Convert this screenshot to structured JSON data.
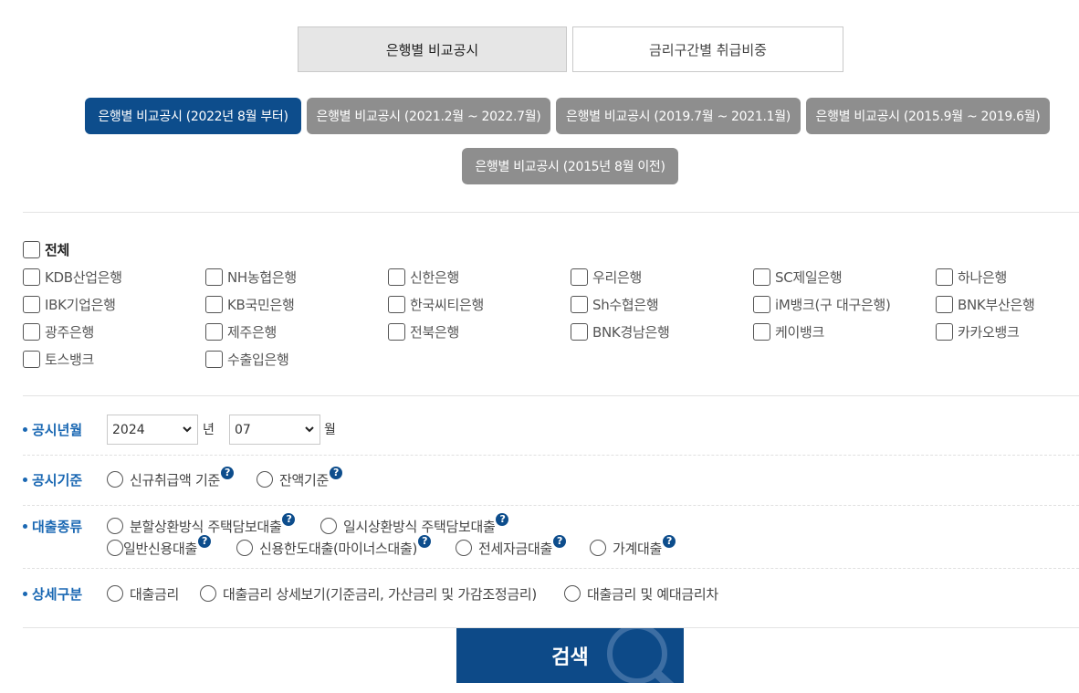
{
  "top_tabs": [
    {
      "label": "은행별 비교공시",
      "active": true
    },
    {
      "label": "금리구간별 취급비중",
      "active": false
    }
  ],
  "period_tabs": [
    {
      "label": "은행별 비교공시 (2022년 8월 부터)",
      "active": true
    },
    {
      "label": "은행별 비교공시 (2021.2월 ~ 2022.7월)",
      "active": false
    },
    {
      "label": "은행별 비교공시 (2019.7월 ~ 2021.1월)",
      "active": false
    },
    {
      "label": "은행별 비교공시 (2015.9월 ~ 2019.6월)",
      "active": false
    },
    {
      "label": "은행별 비교공시 (2015년 8월 이전)",
      "active": false
    }
  ],
  "banks": {
    "all_label": "전체",
    "items": [
      "KDB산업은행",
      "NH농협은행",
      "신한은행",
      "우리은행",
      "SC제일은행",
      "하나은행",
      "IBK기업은행",
      "KB국민은행",
      "한국씨티은행",
      "Sh수협은행",
      "iM뱅크(구 대구은행)",
      "BNK부산은행",
      "광주은행",
      "제주은행",
      "전북은행",
      "BNK경남은행",
      "케이뱅크",
      "카카오뱅크",
      "토스뱅크",
      "수출입은행"
    ]
  },
  "form": {
    "period": {
      "label": "공시년월",
      "year_value": "2024",
      "year_unit": "년",
      "month_value": "07",
      "month_unit": "월"
    },
    "basis": {
      "label": "공시기준",
      "options": [
        "신규취급액 기준",
        "잔액기준"
      ]
    },
    "loan_type": {
      "label": "대출종류",
      "options": [
        "분할상환방식 주택담보대출",
        "일시상환방식 주택담보대출",
        "일반신용대출",
        "신용한도대출(마이너스대출)",
        "전세자금대출",
        "가계대출"
      ]
    },
    "detail": {
      "label": "상세구분",
      "options": [
        "대출금리",
        "대출금리 상세보기(기준금리, 가산금리 및 가감조정금리)",
        "대출금리 및 예대금리차"
      ]
    },
    "help_glyph": "?"
  },
  "search_button": {
    "label": "검색"
  },
  "colors": {
    "primary": "#0d4d8c",
    "pill_inactive": "#8e8e8e",
    "label_blue": "#1a68b3"
  }
}
